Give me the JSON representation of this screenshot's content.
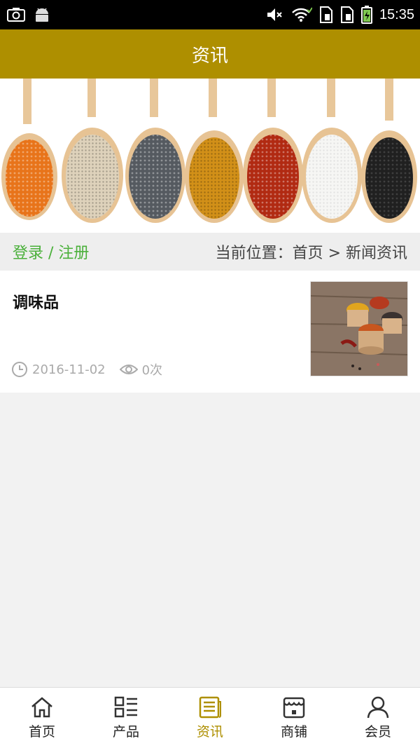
{
  "status_bar": {
    "time": "15:35",
    "icons": [
      "screenshot-icon",
      "android-icon",
      "mute-icon",
      "wifi-icon",
      "sim1-icon",
      "sim2-icon",
      "battery-icon"
    ]
  },
  "header": {
    "title": "资讯"
  },
  "banner": {
    "icon": "spice-spoons-banner"
  },
  "location_bar": {
    "auth_link": "登录 / 注册",
    "breadcrumb": "当前位置：首页 > 新闻资讯"
  },
  "news": {
    "items": [
      {
        "title": "调味品",
        "date": "2016-11-02",
        "views": "0次",
        "thumb_icon": "spice-bowls-thumbnail"
      }
    ]
  },
  "nav": {
    "items": [
      {
        "label": "首页",
        "icon": "home-icon"
      },
      {
        "label": "产品",
        "icon": "grid-list-icon"
      },
      {
        "label": "资讯",
        "icon": "news-icon",
        "active": true
      },
      {
        "label": "商铺",
        "icon": "shop-icon"
      },
      {
        "label": "会员",
        "icon": "user-icon"
      }
    ]
  },
  "colors": {
    "brand": "#ae8f00",
    "auth_link": "#4ab03a",
    "background": "#f2f2f2"
  }
}
